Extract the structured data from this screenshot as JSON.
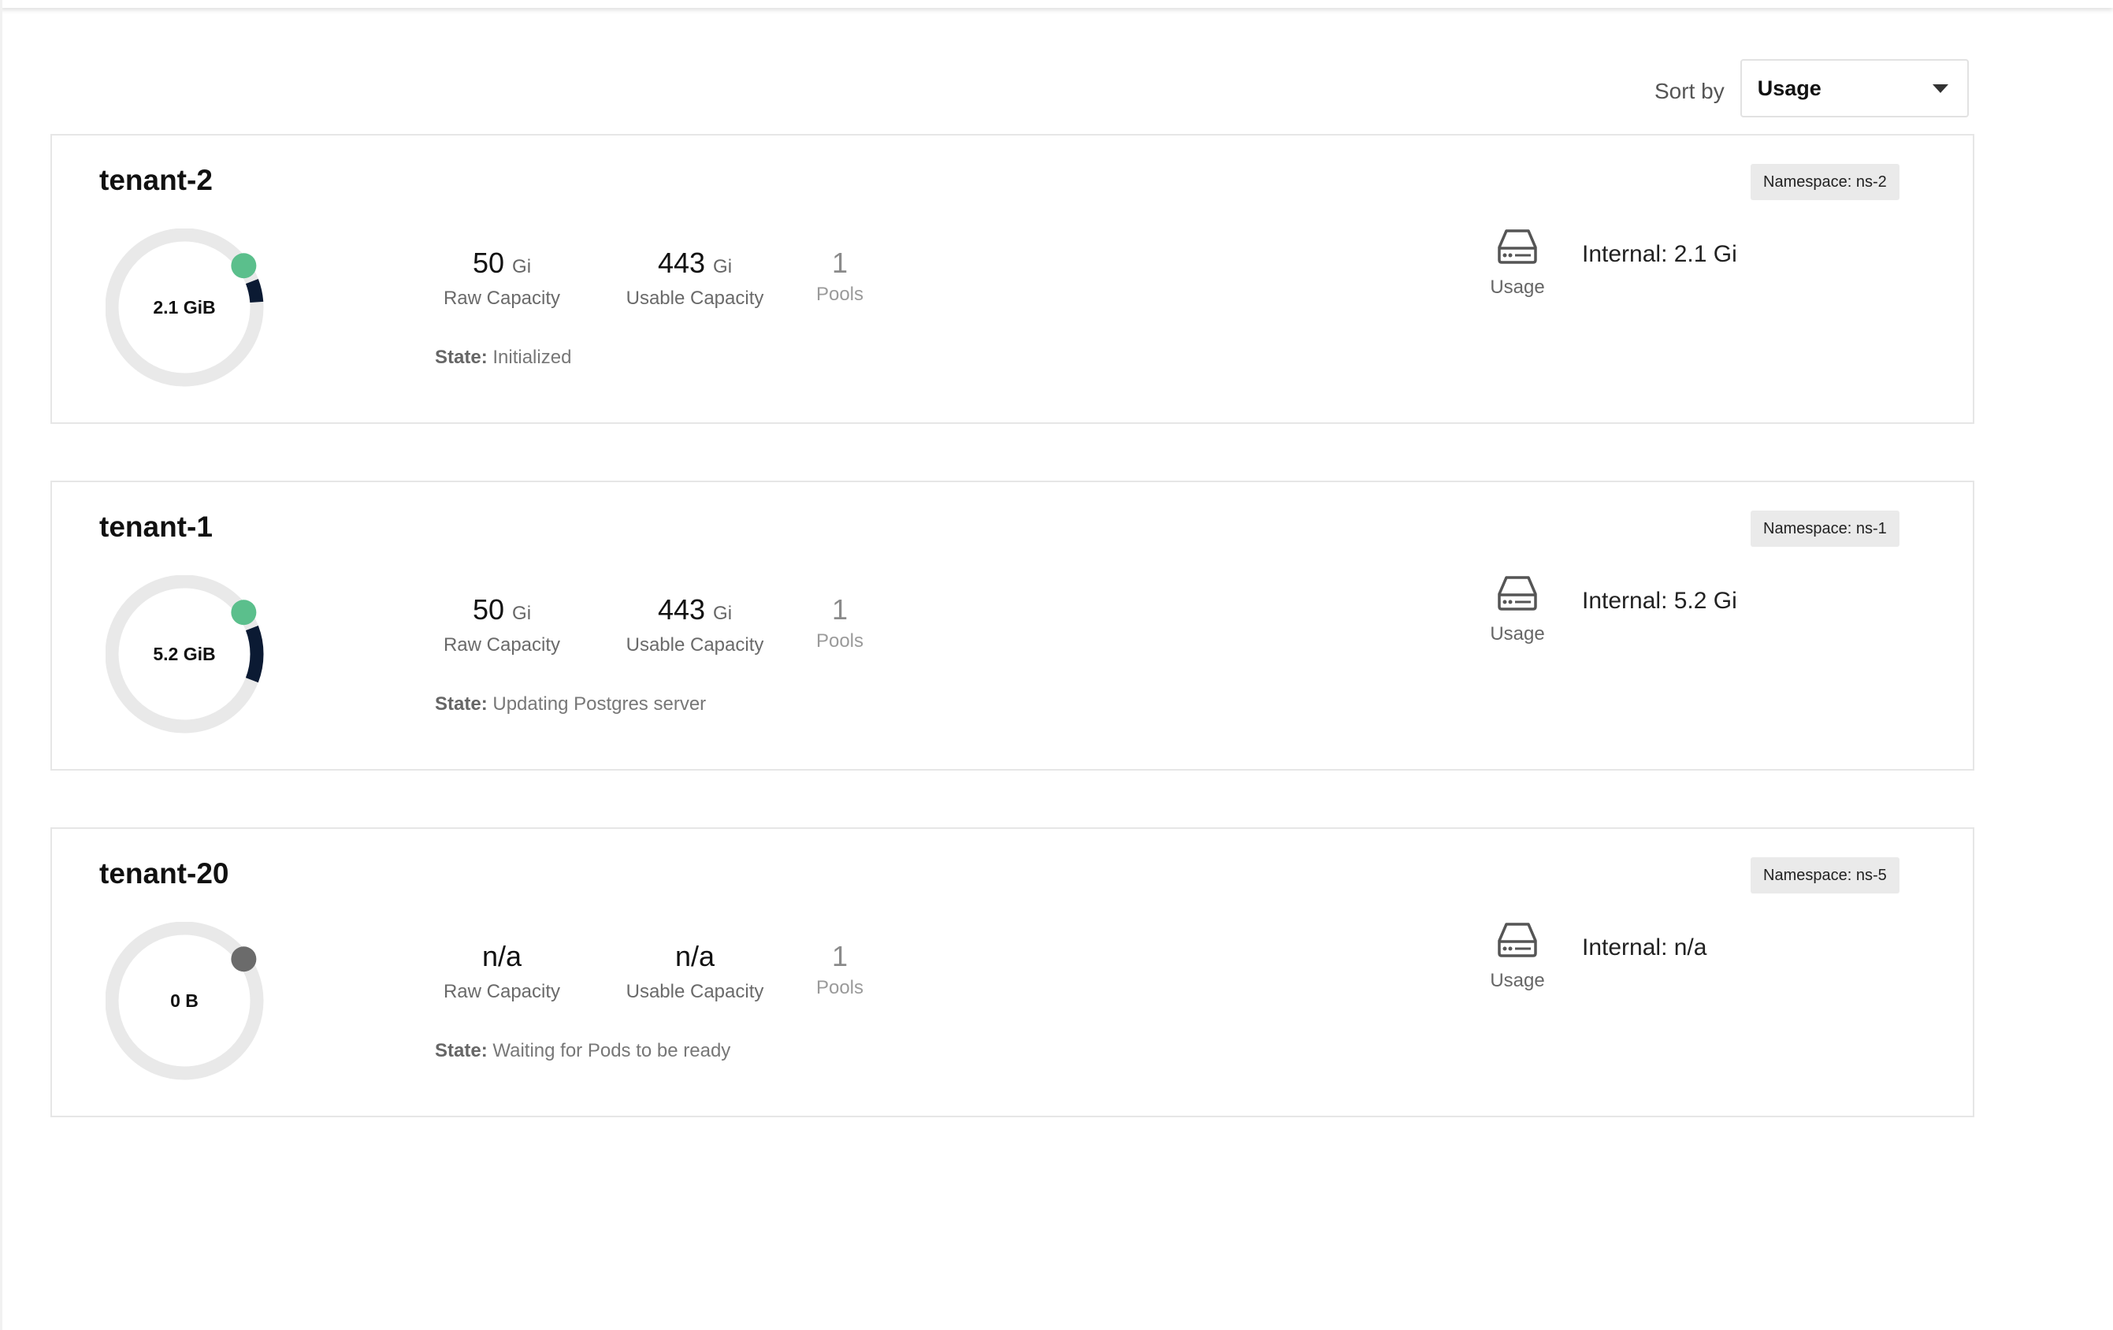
{
  "sort": {
    "label": "Sort by",
    "selected": "Usage"
  },
  "colors": {
    "ok": "#5bbf8c",
    "inactive": "#6b6b6b",
    "usage_arc": "#0b1a33",
    "ring": "#e9e9e9"
  },
  "tenants": [
    {
      "name": "tenant-2",
      "namespace": "Namespace: ns-2",
      "used": "2.1 GiB",
      "usage_fraction": 0.047,
      "status": "ok",
      "raw_capacity": "50",
      "raw_unit": "Gi",
      "usable_capacity": "443",
      "usable_unit": "Gi",
      "pools": "1",
      "raw_label": "Raw Capacity",
      "usable_label": "Usable Capacity",
      "pools_label": "Pools",
      "state_label": "State:",
      "state": "Initialized",
      "usage_label": "Usage",
      "internal": "Internal: 2.1 Gi"
    },
    {
      "name": "tenant-1",
      "namespace": "Namespace: ns-1",
      "used": "5.2 GiB",
      "usage_fraction": 0.117,
      "status": "ok",
      "raw_capacity": "50",
      "raw_unit": "Gi",
      "usable_capacity": "443",
      "usable_unit": "Gi",
      "pools": "1",
      "raw_label": "Raw Capacity",
      "usable_label": "Usable Capacity",
      "pools_label": "Pools",
      "state_label": "State:",
      "state": "Updating Postgres server",
      "usage_label": "Usage",
      "internal": "Internal: 5.2 Gi"
    },
    {
      "name": "tenant-20",
      "namespace": "Namespace: ns-5",
      "used": "0 B",
      "usage_fraction": 0,
      "status": "inactive",
      "raw_capacity": "n/a",
      "raw_unit": "",
      "usable_capacity": "n/a",
      "usable_unit": "",
      "pools": "1",
      "raw_label": "Raw Capacity",
      "usable_label": "Usable Capacity",
      "pools_label": "Pools",
      "state_label": "State:",
      "state": "Waiting for Pods to be ready",
      "usage_label": "Usage",
      "internal": "Internal: n/a"
    }
  ]
}
